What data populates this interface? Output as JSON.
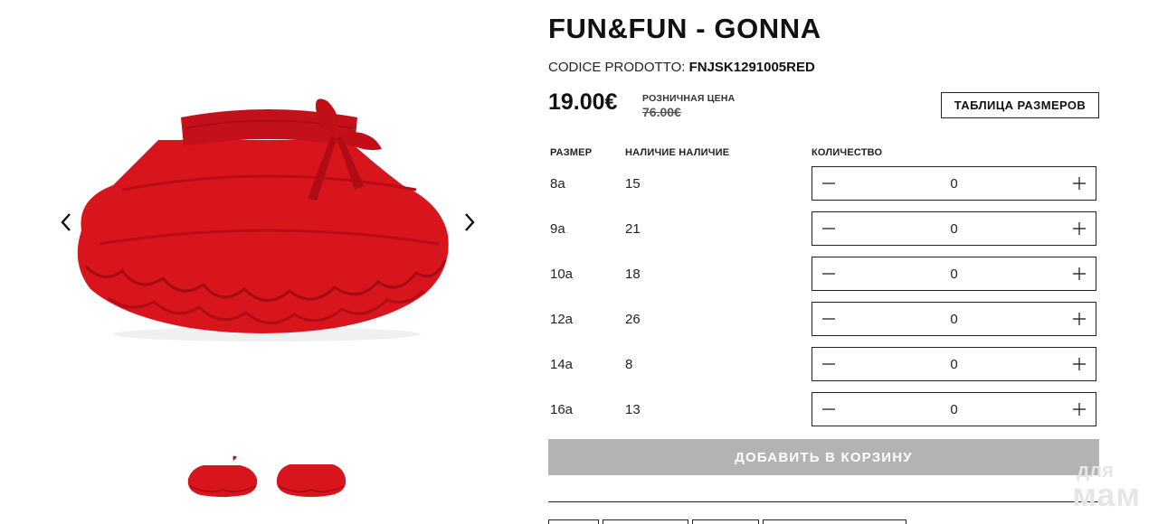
{
  "product": {
    "title": "FUN&FUN - GONNA",
    "code_label": "CODICE PRODOTTO:",
    "code_value": "FNJSK1291005RED",
    "price": "19.00€",
    "retail_label": "РОЗНИЧНАЯ ЦЕНА",
    "retail_price": "76.00€",
    "size_table_button": "ТАБЛИЦА РАЗМЕРОВ"
  },
  "gallery": {
    "prev_icon": "chevron-left-icon",
    "next_icon": "chevron-right-icon",
    "thumbnail_count": 2,
    "accent_color": "#d7141c"
  },
  "table": {
    "headers": {
      "size": "РАЗМЕР",
      "availability": "НАЛИЧИЕ НАЛИЧИЕ",
      "quantity": "КОЛИЧЕСТВО"
    },
    "rows": [
      {
        "size": "8a",
        "available": "15",
        "quantity": "0"
      },
      {
        "size": "9a",
        "available": "21",
        "quantity": "0"
      },
      {
        "size": "10a",
        "available": "18",
        "quantity": "0"
      },
      {
        "size": "12a",
        "available": "26",
        "quantity": "0"
      },
      {
        "size": "14a",
        "available": "8",
        "quantity": "0"
      },
      {
        "size": "16a",
        "available": "13",
        "quantity": "0"
      }
    ]
  },
  "cart": {
    "add_button": "ДОБАВИТЬ В КОРЗИНУ",
    "button_color": "#b3b3b3"
  },
  "watermark": {
    "line1": "для",
    "line2": "мам"
  }
}
